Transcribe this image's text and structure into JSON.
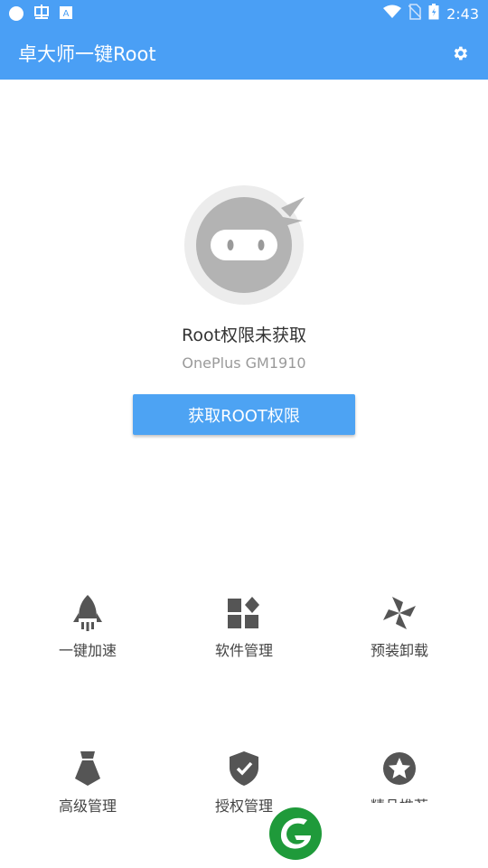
{
  "status_bar": {
    "left_icons": [
      "circle-icon",
      "bug-icon",
      "font-icon"
    ],
    "time": "2:43"
  },
  "app_bar": {
    "title": "卓大师一键Root",
    "settings_icon": "gear-icon"
  },
  "root_status": {
    "status_text": "Root权限未获取",
    "device": "OnePlus GM1910",
    "button_label": "获取ROOT权限"
  },
  "tools": [
    {
      "label": "一键加速",
      "icon": "rocket-icon"
    },
    {
      "label": "软件管理",
      "icon": "apps-icon"
    },
    {
      "label": "预装卸载",
      "icon": "pinwheel-icon"
    },
    {
      "label": "高级管理",
      "icon": "tie-icon"
    },
    {
      "label": "授权管理",
      "icon": "shield-check-icon"
    },
    {
      "label": "精品推荐",
      "icon": "star-icon"
    }
  ],
  "colors": {
    "primary": "#4a9ff5",
    "button": "#4da3f3",
    "icon_gray": "#555555",
    "logo_green": "#1f9a3a"
  }
}
